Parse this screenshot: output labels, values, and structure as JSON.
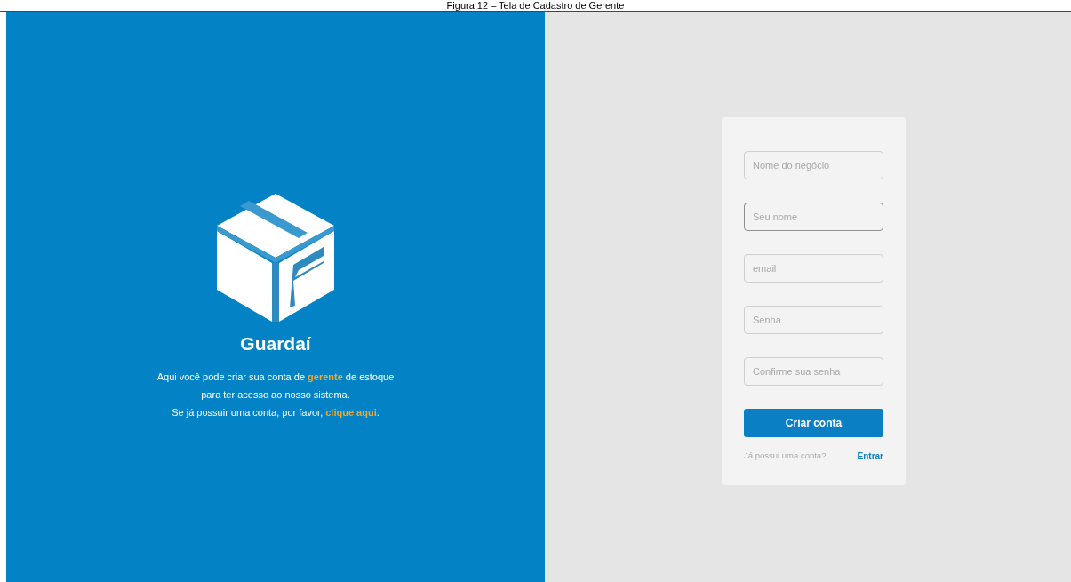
{
  "caption": "Figura 12 – Tela de Cadastro de Gerente",
  "brand": {
    "name": "Guardaí"
  },
  "intro": [
    {
      "kind": "text",
      "text": "Aqui você pode criar sua conta de "
    },
    {
      "kind": "highlight",
      "text": "gerente"
    },
    {
      "kind": "text",
      "text": " de estoque para ter acesso ao nosso sistema."
    }
  ],
  "login_prompt": [
    {
      "kind": "text",
      "text": "Se já possuir uma conta, por favor, "
    },
    {
      "kind": "link",
      "text": "clique aqui"
    },
    {
      "kind": "text",
      "text": "."
    }
  ],
  "form": {
    "fields": [
      {
        "placeholder": "Nome do negócio",
        "focused": false
      },
      {
        "placeholder": "Seu nome",
        "focused": true
      },
      {
        "placeholder": "email",
        "focused": false
      },
      {
        "placeholder": "Senha",
        "focused": false
      },
      {
        "placeholder": "Confirme sua senha",
        "focused": false
      }
    ],
    "submit": "Criar conta",
    "footer_text": "Já possui uma conta?",
    "footer_link": "Entrar"
  }
}
